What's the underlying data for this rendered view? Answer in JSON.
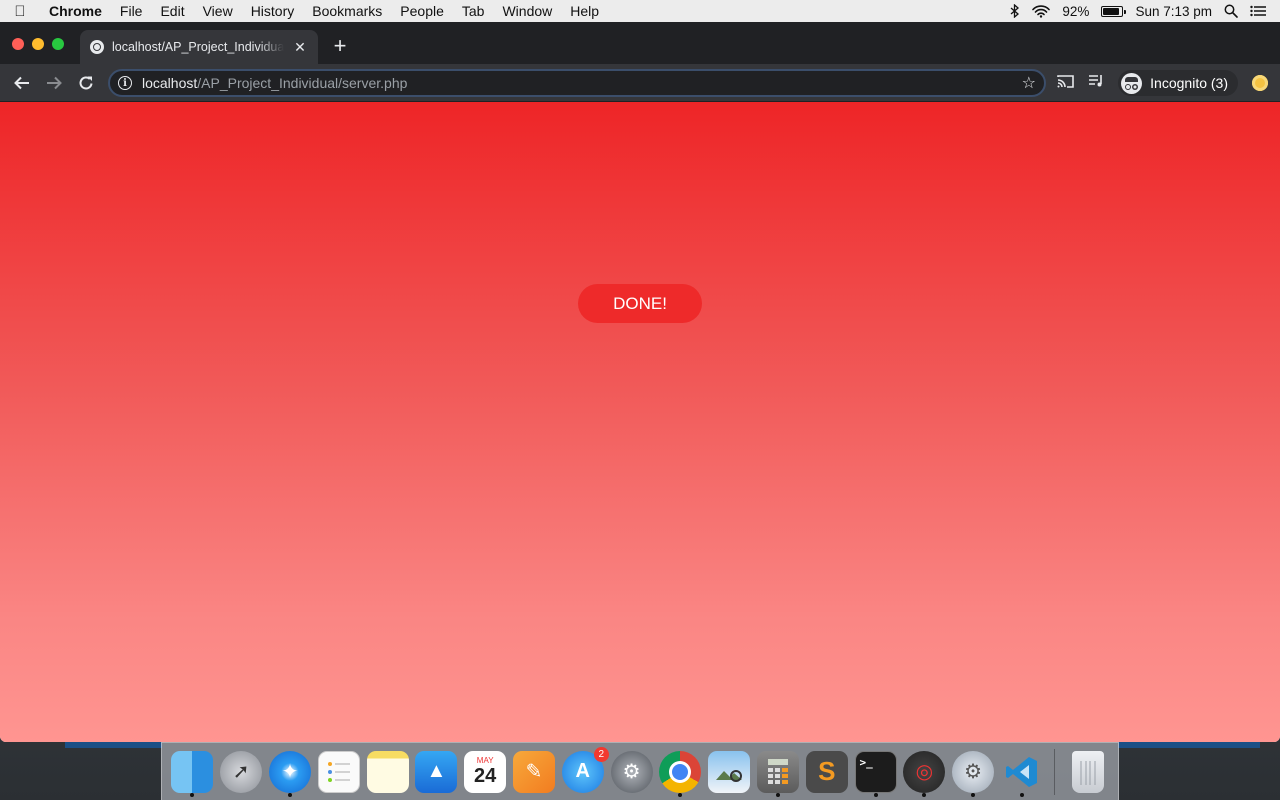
{
  "menubar": {
    "apple_icon": "apple-logo-icon",
    "app_name": "Chrome",
    "items": [
      "File",
      "Edit",
      "View",
      "History",
      "Bookmarks",
      "People",
      "Tab",
      "Window",
      "Help"
    ],
    "battery_percent": "92%",
    "clock": "Sun 7:13 pm"
  },
  "browser": {
    "tab_title": "localhost/AP_Project_Individual/server.php",
    "url_host": "localhost",
    "url_path": "/AP_Project_Individual/server.php",
    "profile_label": "Incognito (3)"
  },
  "page": {
    "button_label": "DONE!",
    "colors": {
      "gradient_top": "#ee2527",
      "gradient_bottom": "#ff9591",
      "button": "#ee2a2a"
    }
  },
  "dock": {
    "apps": [
      {
        "name": "finder",
        "icon": "finder-icon",
        "running": true
      },
      {
        "name": "launchpad",
        "icon": "launchpad-icon",
        "running": false
      },
      {
        "name": "safari",
        "icon": "safari-icon",
        "running": true
      },
      {
        "name": "reminders",
        "icon": "reminders-icon",
        "running": false
      },
      {
        "name": "notes",
        "icon": "notes-icon",
        "running": false
      },
      {
        "name": "keynote",
        "icon": "keynote-icon",
        "running": false
      },
      {
        "name": "calendar",
        "icon": "calendar-icon",
        "running": false,
        "month": "MAY",
        "day": "24"
      },
      {
        "name": "pages",
        "icon": "pages-icon",
        "running": false
      },
      {
        "name": "app-store",
        "icon": "app-store-icon",
        "running": false,
        "badge": "2"
      },
      {
        "name": "system-preferences",
        "icon": "system-preferences-icon",
        "running": false
      },
      {
        "name": "chrome",
        "icon": "chrome-icon",
        "running": true
      },
      {
        "name": "preview",
        "icon": "preview-icon",
        "running": false
      },
      {
        "name": "calculator",
        "icon": "calculator-icon",
        "running": true
      },
      {
        "name": "sublime-text",
        "icon": "sublime-text-icon",
        "running": false
      },
      {
        "name": "terminal",
        "icon": "terminal-icon",
        "running": true
      },
      {
        "name": "instruments",
        "icon": "instruments-icon",
        "running": true
      },
      {
        "name": "system-preferences-2",
        "icon": "settings-gear-icon",
        "running": true
      },
      {
        "name": "vscode",
        "icon": "vscode-icon",
        "running": true
      }
    ],
    "trash": {
      "name": "trash",
      "icon": "trash-icon"
    }
  }
}
